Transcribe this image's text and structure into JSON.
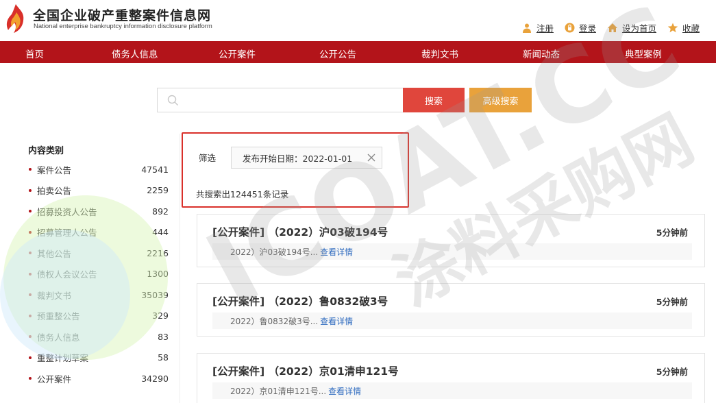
{
  "header": {
    "title": "全国企业破产重整案件信息网",
    "subtitle": "National enterprise bankruptcy  information disclosure platform",
    "links": [
      {
        "label": "注册",
        "icon": "user-icon"
      },
      {
        "label": "登录",
        "icon": "login-icon"
      },
      {
        "label": "设为首页",
        "icon": "home-icon"
      },
      {
        "label": "收藏",
        "icon": "star-icon"
      }
    ]
  },
  "nav": {
    "items": [
      "首页",
      "债务人信息",
      "公开案件",
      "公开公告",
      "裁判文书",
      "新闻动态",
      "典型案例"
    ]
  },
  "search": {
    "placeholder": "",
    "value": "",
    "search_label": "搜索",
    "advanced_label": "高级搜索"
  },
  "sidebar": {
    "title": "内容类别",
    "items": [
      {
        "name": "案件公告",
        "count": "47541"
      },
      {
        "name": "拍卖公告",
        "count": "2259"
      },
      {
        "name": "招募投资人公告",
        "count": "892"
      },
      {
        "name": "招募管理人公告",
        "count": "444"
      },
      {
        "name": "其他公告",
        "count": "2216"
      },
      {
        "name": "债权人会议公告",
        "count": "1300"
      },
      {
        "name": "裁判文书",
        "count": "35039"
      },
      {
        "name": "预重整公告",
        "count": "329"
      },
      {
        "name": "债务人信息",
        "count": "83"
      },
      {
        "name": "重整计划草案",
        "count": "58"
      },
      {
        "name": "公开案件",
        "count": "34290"
      }
    ]
  },
  "filter": {
    "label": "筛选",
    "chip": "发布开始日期：2022-01-01",
    "result_count": "共搜索出124451条记录"
  },
  "results": [
    {
      "title": "[公开案件] （2022）沪03破194号",
      "time": "5分钟前",
      "snippet": "2022）沪03破194号...",
      "link": "查看详情"
    },
    {
      "title": "[公开案件] （2022）鲁0832破3号",
      "time": "5分钟前",
      "snippet": "2022）鲁0832破3号...",
      "link": "查看详情"
    },
    {
      "title": "[公开案件] （2022）京01清申121号",
      "time": "5分钟前",
      "snippet": "2022）京01清申121号...",
      "link": "查看详情"
    }
  ],
  "watermark": {
    "text_latin": "ICOAT.CC",
    "text_cn": "涂料采购网"
  },
  "colors": {
    "nav_bg": "#b3141a",
    "search_btn": "#e0463c",
    "advanced_btn": "#e9a23b",
    "filter_border": "#d9302a",
    "link": "#2f6bbf"
  }
}
